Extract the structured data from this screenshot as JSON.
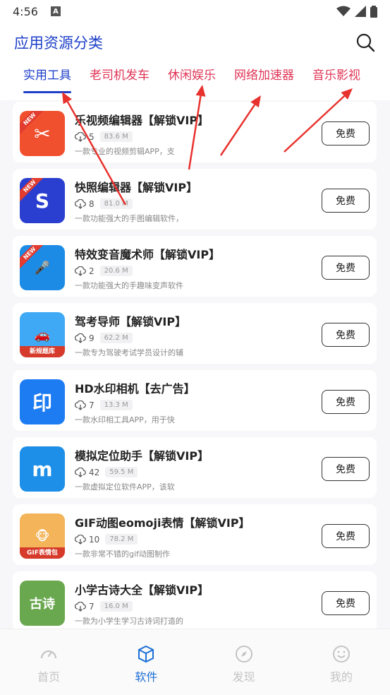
{
  "status_bar": {
    "time": "4:56",
    "notification_letter": "A"
  },
  "header": {
    "title": "应用资源分类"
  },
  "tabs": [
    {
      "label": "实用工具",
      "active": true
    },
    {
      "label": "老司机发车",
      "active": false
    },
    {
      "label": "休闲娱乐",
      "active": false
    },
    {
      "label": "网络加速器",
      "active": false
    },
    {
      "label": "音乐影视",
      "active": false
    }
  ],
  "apps": [
    {
      "name": "乐视频编辑器【解锁VIP】",
      "downloads": "5",
      "size": "83.6 M",
      "desc": "一款专业的视频剪辑APP，支",
      "button": "免费",
      "new": true,
      "icon": "video-editor-icon",
      "icon_color": "#f0502e",
      "icon_glyph": "✂"
    },
    {
      "name": "快照编辑器【解锁VIP】",
      "downloads": "8",
      "size": "81.0 M",
      "desc": "一款功能强大的手图编辑软件，",
      "button": "免费",
      "new": true,
      "icon": "snapshot-editor-icon",
      "icon_color": "#2a3fd0",
      "icon_glyph": "S"
    },
    {
      "name": "特效变音魔术师【解锁VIP】",
      "downloads": "2",
      "size": "20.6 M",
      "desc": "一款功能强大的手趣味变声软件",
      "button": "免费",
      "new": true,
      "icon": "voice-changer-icon",
      "icon_color": "#1b8be6",
      "icon_glyph": "🎤"
    },
    {
      "name": "驾考导师【解锁VIP】",
      "downloads": "9",
      "size": "62.2 M",
      "desc": "一款专为驾驶考试学员设计的辅",
      "button": "免费",
      "new": false,
      "icon": "driving-test-icon",
      "icon_color": "#3fa9f5",
      "icon_glyph": "🚗",
      "icon_caption": "新规题库"
    },
    {
      "name": "HD水印相机【去广告】",
      "downloads": "7",
      "size": "13.3 M",
      "desc": "一款水印相工具APP，用于快",
      "button": "免费",
      "new": false,
      "icon": "watermark-camera-icon",
      "icon_color": "#1d7cf2",
      "icon_glyph": "印"
    },
    {
      "name": "模拟定位助手【解锁VIP】",
      "downloads": "42",
      "size": "59.5 M",
      "desc": "一款虚拟定位软件APP，该软",
      "button": "免费",
      "new": false,
      "icon": "location-icon",
      "icon_color": "#1d8fe8",
      "icon_glyph": "m"
    },
    {
      "name": "GIF动图eomoji表情【解锁VIP】",
      "downloads": "10",
      "size": "78.2 M",
      "desc": "一款非常不错的gif动图制作",
      "button": "免费",
      "new": false,
      "icon": "gif-emoji-icon",
      "icon_color": "#f3b45a",
      "icon_glyph": "🐵",
      "icon_caption": "GIF表情包"
    },
    {
      "name": "小学古诗大全【解锁VIP】",
      "downloads": "7",
      "size": "16.0 M",
      "desc": "一款为小学生学习古诗词打造的",
      "button": "免费",
      "new": false,
      "icon": "poetry-icon",
      "icon_color": "#6aa84f",
      "icon_glyph": "古诗"
    }
  ],
  "new_badge_text": "NEW",
  "bottom_nav": [
    {
      "label": "首页",
      "icon": "home-gauge-icon",
      "active": false
    },
    {
      "label": "软件",
      "icon": "software-box-icon",
      "active": true
    },
    {
      "label": "发现",
      "icon": "compass-icon",
      "active": false
    },
    {
      "label": "我的",
      "icon": "smiley-icon",
      "active": false
    }
  ],
  "colors": {
    "accent": "#1d3fc9",
    "tab_inactive": "#e03355",
    "nav_active": "#1d6fd6",
    "arrow": "#e8322e"
  }
}
